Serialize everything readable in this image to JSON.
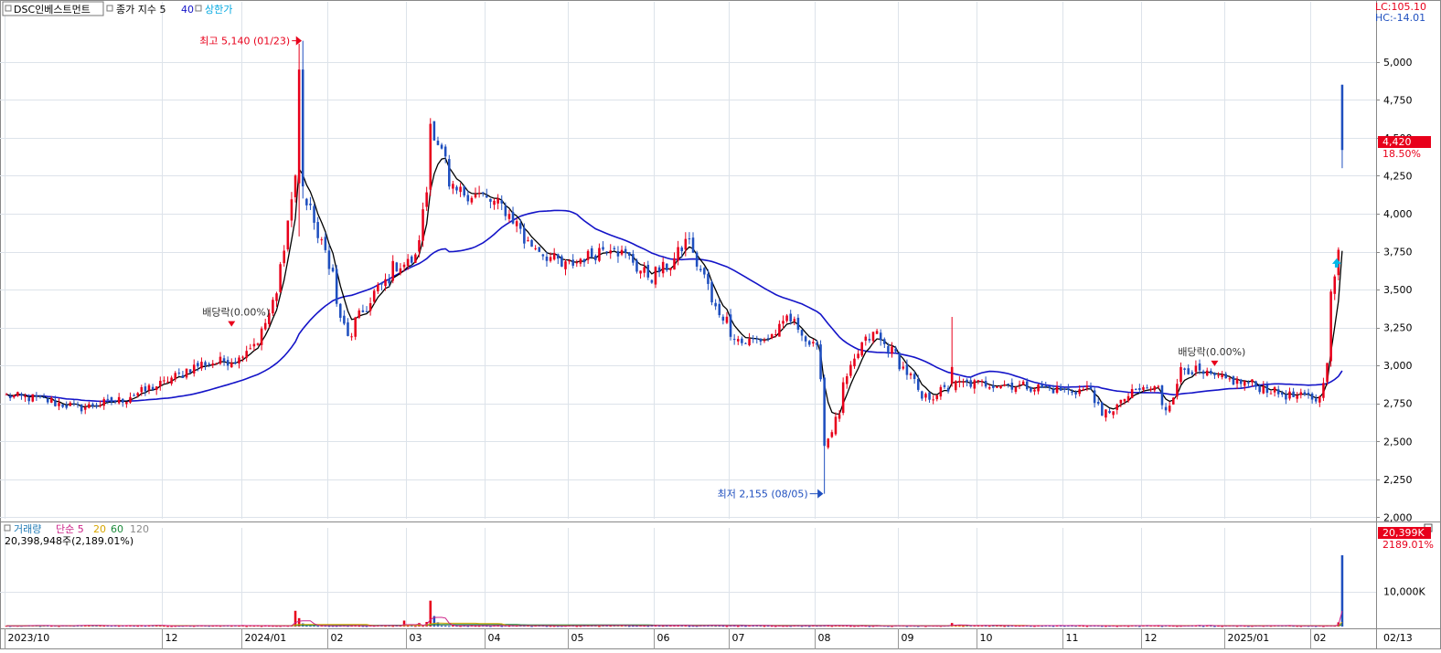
{
  "header": {
    "stock_name": "DSC인베스트먼트",
    "ma_label": "종가 지수 5",
    "ma_period2": "40",
    "limit_label": "상한가",
    "lc_label": "LC:105.10",
    "hc_label": "HC:-14.01"
  },
  "volume_header": {
    "label": "거래량",
    "ma_label": "단순 5",
    "p20": "20",
    "p60": "60",
    "p120": "120",
    "summary": "20,398,948주(2,189.01%)"
  },
  "annotations": {
    "high": "최고 5,140 (01/23)",
    "low": "최저 2,155 (08/05)",
    "dividend1": "배당락(0.00%)",
    "dividend2": "배당락(0.00%)"
  },
  "price_badge": {
    "value": "4,420",
    "pct": "18.50%"
  },
  "volume_badge": {
    "value": "20,399K",
    "pct": "2189.01%"
  },
  "date_end": "02/13",
  "colors": {
    "up": "#e8001b",
    "down": "#1f4fbf",
    "ma5": "#000000",
    "ma40": "#1414c8",
    "limit": "#00a8e0",
    "grid": "#dde3ea",
    "vol20": "#d7a600",
    "vol60": "#1a8a3a",
    "vol120": "#8a8a8a",
    "volma5": "#cc2288"
  },
  "chart_data": [
    {
      "type": "candlestick",
      "title": "DSC인베스트먼트",
      "y_ticks": [
        2000,
        2250,
        2500,
        2750,
        3000,
        3250,
        3500,
        3750,
        4000,
        4250,
        4500,
        4750,
        5000
      ],
      "y_tick_labels": [
        "2,000",
        "2,250",
        "2,500",
        "2,750",
        "3,000",
        "3,250",
        "3,500",
        "3,750",
        "4,000",
        "4,250",
        "4,500",
        "4,750",
        "5,000"
      ],
      "ylim": [
        1990,
        5300
      ],
      "x_ticks": [
        "2023/10",
        "12",
        "2024/01",
        "02",
        "03",
        "04",
        "05",
        "06",
        "07",
        "08",
        "09",
        "10",
        "11",
        "12",
        "2025/01",
        "02"
      ],
      "anchors_close": [
        [
          "2023-10-04",
          2800
        ],
        [
          "2023-10-16",
          2780
        ],
        [
          "2023-10-31",
          2720
        ],
        [
          "2023-11-15",
          2770
        ],
        [
          "2023-12-01",
          2880
        ],
        [
          "2023-12-15",
          3010
        ],
        [
          "2023-12-29",
          3040
        ],
        [
          "2024-01-08",
          3220
        ],
        [
          "2024-01-15",
          3650
        ],
        [
          "2024-01-19",
          4250
        ],
        [
          "2024-01-23",
          4100
        ],
        [
          "2024-01-31",
          3750
        ],
        [
          "2024-02-08",
          3180
        ],
        [
          "2024-02-15",
          3380
        ],
        [
          "2024-02-26",
          3650
        ],
        [
          "2024-03-05",
          3700
        ],
        [
          "2024-03-11",
          4600
        ],
        [
          "2024-03-18",
          4150
        ],
        [
          "2024-03-29",
          4120
        ],
        [
          "2024-04-08",
          4020
        ],
        [
          "2024-04-15",
          3820
        ],
        [
          "2024-04-29",
          3650
        ],
        [
          "2024-05-08",
          3720
        ],
        [
          "2024-05-17",
          3800
        ],
        [
          "2024-05-31",
          3580
        ],
        [
          "2024-06-10",
          3700
        ],
        [
          "2024-06-14",
          3850
        ],
        [
          "2024-06-24",
          3400
        ],
        [
          "2024-07-04",
          3150
        ],
        [
          "2024-07-15",
          3180
        ],
        [
          "2024-07-22",
          3320
        ],
        [
          "2024-08-01",
          3100
        ],
        [
          "2024-08-05",
          2470
        ],
        [
          "2024-08-16",
          3080
        ],
        [
          "2024-08-23",
          3220
        ],
        [
          "2024-09-02",
          3010
        ],
        [
          "2024-09-10",
          2780
        ],
        [
          "2024-09-24",
          2880
        ],
        [
          "2024-10-08",
          2880
        ],
        [
          "2024-10-21",
          2860
        ],
        [
          "2024-11-04",
          2830
        ],
        [
          "2024-11-12",
          2850
        ],
        [
          "2024-11-15",
          2650
        ],
        [
          "2024-11-29",
          2840
        ],
        [
          "2024-12-06",
          2850
        ],
        [
          "2024-12-10",
          2720
        ],
        [
          "2024-12-16",
          2990
        ],
        [
          "2024-12-27",
          2920
        ],
        [
          "2025-01-10",
          2880
        ],
        [
          "2025-01-24",
          2800
        ],
        [
          "2025-02-05",
          2780
        ],
        [
          "2025-02-12",
          3730
        ],
        [
          "2025-02-13",
          4420
        ]
      ],
      "special_bars": [
        {
          "date": "2024-01-22",
          "open": 4200,
          "high": 5120,
          "low": 3850,
          "close": 4950
        },
        {
          "date": "2024-01-23",
          "open": 4950,
          "high": 5140,
          "low": 4100,
          "close": 4180
        },
        {
          "date": "2024-08-05",
          "open": 2920,
          "high": 2940,
          "low": 2155,
          "close": 2470
        },
        {
          "date": "2024-09-20",
          "open": 2880,
          "high": 3320,
          "low": 2860,
          "close": 2990
        },
        {
          "date": "2025-02-13",
          "open": 4850,
          "high": 4850,
          "low": 4300,
          "close": 4420
        }
      ],
      "annotations": [
        {
          "text": "최고 5,140 (01/23)",
          "date": "2024-01-23",
          "price": 5140
        },
        {
          "text": "최저 2,155 (08/05)",
          "date": "2024-08-05",
          "price": 2155
        },
        {
          "text": "배당락(0.00%)",
          "date": "2023-12-27",
          "price": 3220
        },
        {
          "text": "배당락(0.00%)",
          "date": "2024-12-27",
          "price": 2960
        }
      ],
      "last_close": 4420,
      "last_change_pct": 18.5,
      "series": [
        {
          "name": "5",
          "type": "line"
        },
        {
          "name": "40",
          "type": "line"
        }
      ]
    },
    {
      "type": "bar",
      "title": "거래량",
      "y_ticks": [
        10000
      ],
      "y_tick_labels": [
        "10,000K"
      ],
      "ylim": [
        0,
        23000
      ],
      "volume_spikes_k": [
        [
          "2024-01-19",
          4500
        ],
        [
          "2024-01-22",
          2400
        ],
        [
          "2024-01-23",
          900
        ],
        [
          "2024-02-29",
          1700
        ],
        [
          "2024-03-06",
          1000
        ],
        [
          "2024-03-08",
          1300
        ],
        [
          "2024-03-11",
          7400
        ],
        [
          "2024-03-12",
          3000
        ],
        [
          "2024-03-13",
          1200
        ],
        [
          "2024-09-20",
          1000
        ],
        [
          "2025-02-12",
          1200
        ],
        [
          "2025-02-13",
          20399
        ]
      ],
      "last_volume": "20,398,948주",
      "last_volume_pct": "2,189.01%",
      "series": [
        {
          "name": "5",
          "type": "line"
        },
        {
          "name": "20",
          "type": "line"
        },
        {
          "name": "60",
          "type": "line"
        },
        {
          "name": "120",
          "type": "line"
        }
      ]
    }
  ]
}
